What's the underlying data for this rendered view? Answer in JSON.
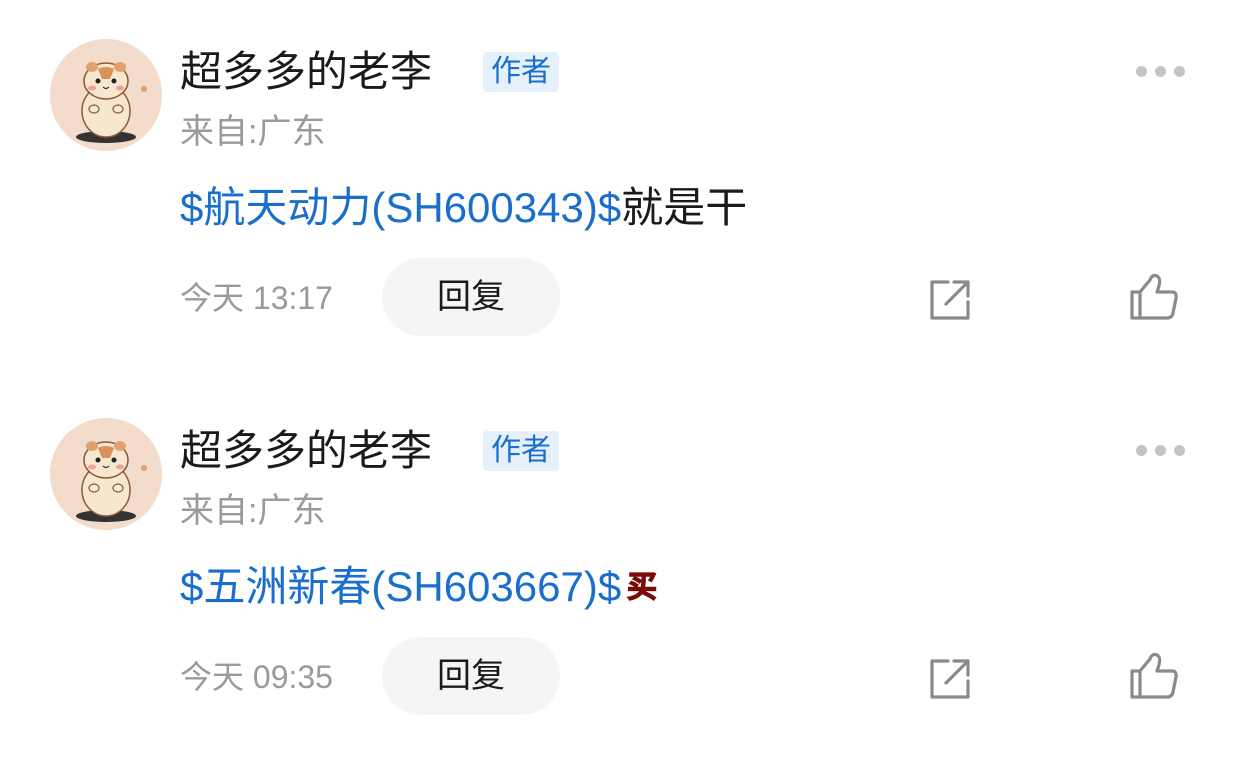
{
  "comments": [
    {
      "username": "超多多的老李",
      "badge": "作者",
      "location": "来自:广东",
      "stock_link": "$航天动力(SH600343)$",
      "text": "就是干",
      "emoji": "",
      "time": "今天 13:17",
      "reply_label": "回复",
      "icons": [
        "more-dots-icon",
        "share-icon",
        "thumbs-up-icon"
      ]
    },
    {
      "username": "超多多的老李",
      "badge": "作者",
      "location": "来自:广东",
      "stock_link": "$五洲新春(SH603667)$",
      "text": "",
      "emoji": "买",
      "time": "今天 09:35",
      "reply_label": "回复",
      "icons": [
        "more-dots-icon",
        "share-icon",
        "thumbs-up-icon"
      ]
    }
  ],
  "colors": {
    "link_blue": "#1a6fcc",
    "badge_bg": "#e6f0fb",
    "muted_gray": "#9a9a9a",
    "reply_bg": "#f4f5f7",
    "emoji_red": "#e8261c"
  }
}
